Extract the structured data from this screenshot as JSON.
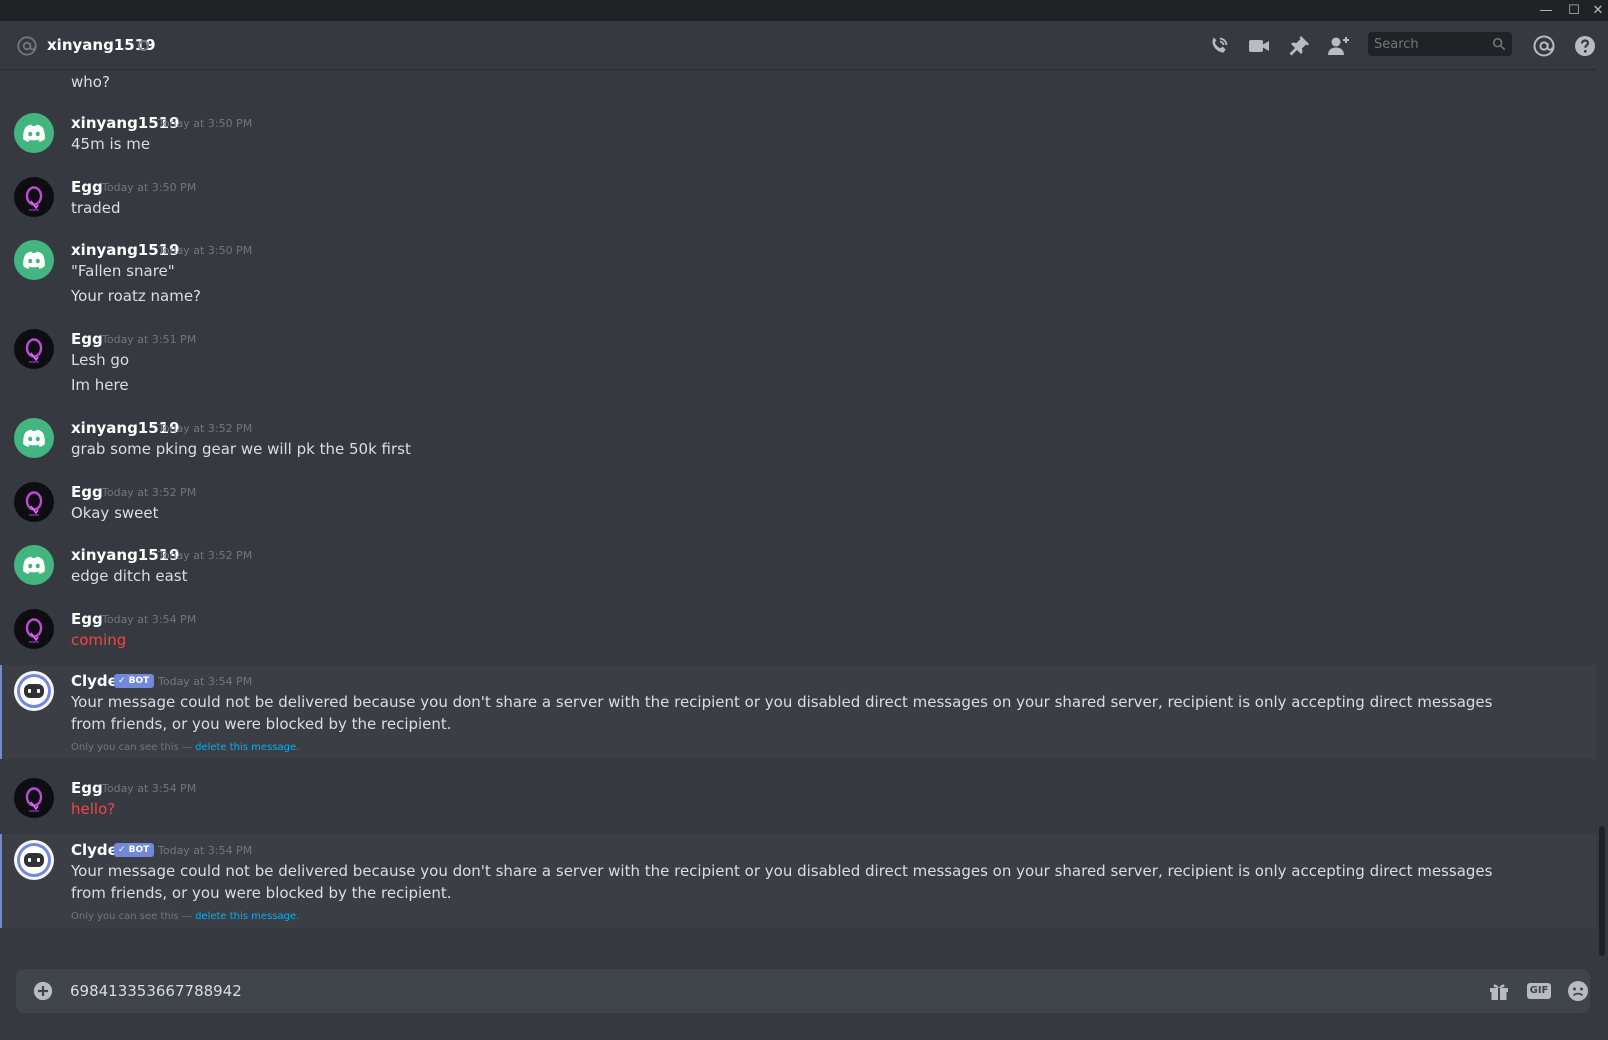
{
  "window": {
    "minimize": "—",
    "maximize": "☐",
    "close": "✕"
  },
  "header": {
    "channel_name": "xinyang1519",
    "search_placeholder": "Search",
    "icons": [
      "at-icon",
      "voice-call-icon",
      "video-call-icon",
      "pin-icon",
      "add-friend-icon",
      "search-icon",
      "mentions-icon",
      "help-icon"
    ]
  },
  "colors": {
    "background": "#36393f",
    "header_bar": "#202225",
    "accent": "#7289da",
    "error_red": "#f04747",
    "link": "#00b0f4",
    "online_green": "#43b581"
  },
  "messages": {
    "m0": {
      "lines": [
        "who?"
      ]
    },
    "m1": {
      "author": "xinyang1519",
      "timestamp": "Today at 3:50 PM",
      "lines": [
        "45m is me"
      ]
    },
    "m2": {
      "author": "Egg",
      "timestamp": "Today at 3:50 PM",
      "lines": [
        "traded"
      ]
    },
    "m3": {
      "author": "xinyang1519",
      "timestamp": "Today at 3:50 PM",
      "lines": [
        "\"Fallen snare\"",
        "Your roatz name?"
      ]
    },
    "m4": {
      "author": "Egg",
      "timestamp": "Today at 3:51 PM",
      "lines": [
        "Lesh go",
        "Im here"
      ]
    },
    "m5": {
      "author": "xinyang1519",
      "timestamp": "Today at 3:52 PM",
      "lines": [
        "grab some pking gear we will pk the 50k first"
      ]
    },
    "m6": {
      "author": "Egg",
      "timestamp": "Today at 3:52 PM",
      "lines": [
        "Okay sweet"
      ]
    },
    "m7": {
      "author": "xinyang1519",
      "timestamp": "Today at 3:52 PM",
      "lines": [
        "edge ditch east"
      ]
    },
    "m8": {
      "author": "Egg",
      "timestamp": "Today at 3:54 PM",
      "lines": [
        "coming"
      ],
      "failed": true
    },
    "m9": {
      "author": "Clyde",
      "bot_tag": "✓ BOT",
      "timestamp": "Today at 3:54 PM",
      "text": "Your message could not be delivered because you don't share a server with the recipient or you disabled direct messages on your shared server, recipient is only accepting direct messages from friends, or you were blocked by the recipient.",
      "note": "Only you can see this — ",
      "note_link": "delete this message."
    },
    "m10": {
      "author": "Egg",
      "timestamp": "Today at 3:54 PM",
      "lines": [
        "hello?"
      ],
      "failed": true
    },
    "m11": {
      "author": "Clyde",
      "bot_tag": "✓ BOT",
      "timestamp": "Today at 3:54 PM",
      "text": "Your message could not be delivered because you don't share a server with the recipient or you disabled direct messages on your shared server, recipient is only accepting direct messages from friends, or you were blocked by the recipient.",
      "note": "Only you can see this — ",
      "note_link": "delete this message."
    }
  },
  "composer": {
    "value": "698413353667788942",
    "icons": [
      "upload-plus-icon",
      "gift-icon",
      "gif-icon",
      "emoji-icon"
    ],
    "gif_label": "GIF"
  }
}
